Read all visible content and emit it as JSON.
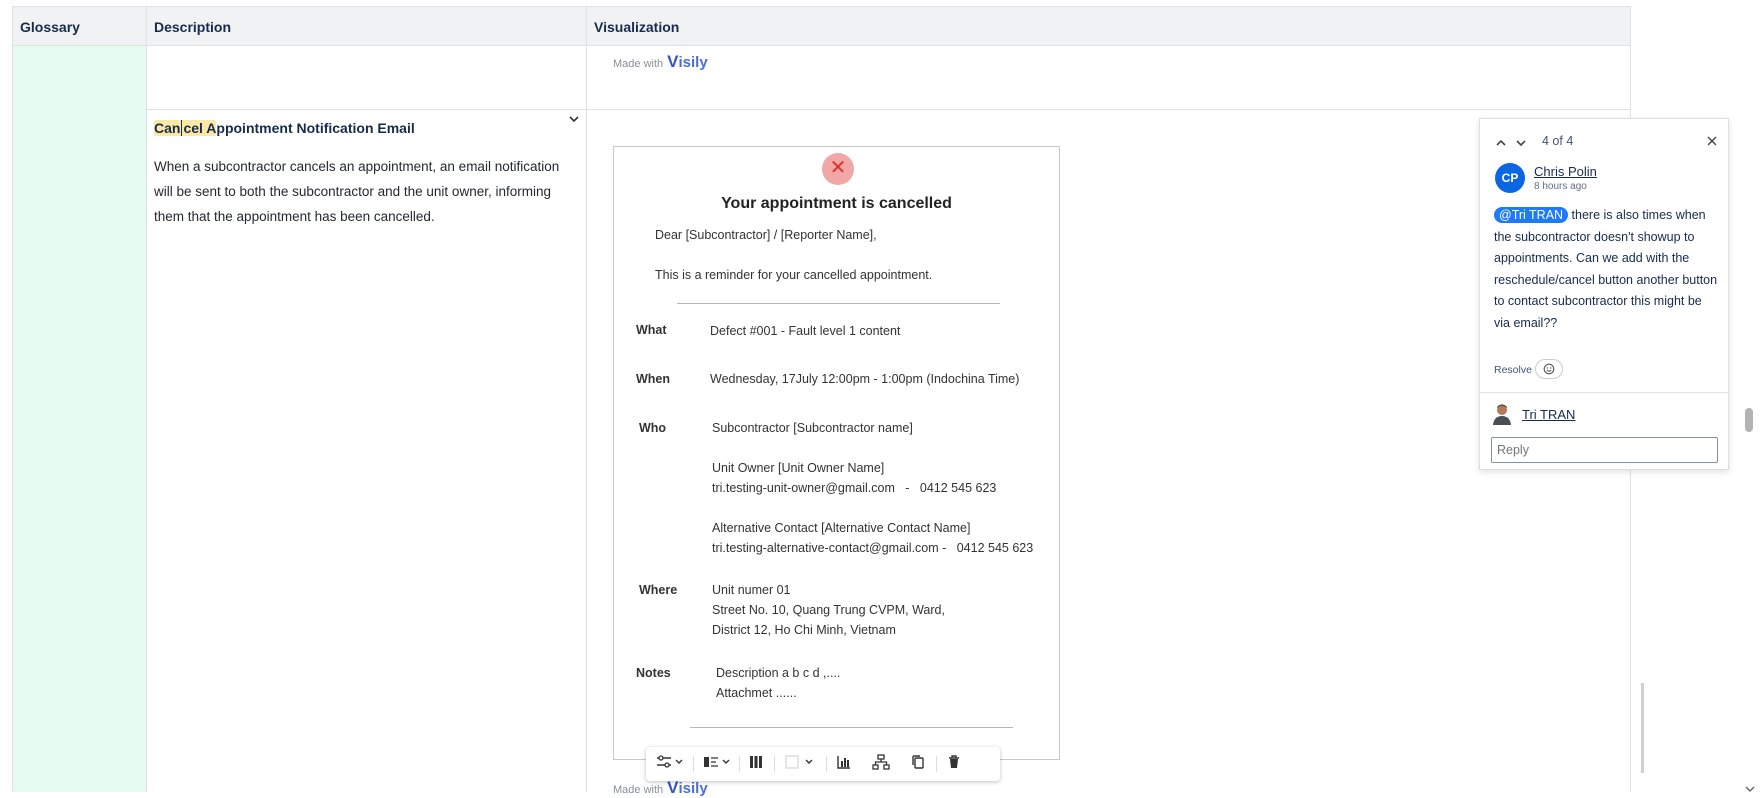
{
  "table": {
    "headers": [
      "Glossary",
      "Description",
      "Visualization"
    ]
  },
  "made_with": {
    "prefix": "Made with",
    "brand": "isily",
    "brand_initial": "V"
  },
  "row": {
    "title_highlight": [
      "Can",
      "cel A"
    ],
    "title_rest": "ppointment Notification Email",
    "description": "When a subcontractor cancels an appointment, an email notification will be sent to both the subcontractor and the unit owner, informing them that the appointment has been cancelled."
  },
  "email": {
    "close_glyph": "✕",
    "title": "Your appointment is cancelled",
    "greeting": "Dear [Subcontractor] / [Reporter Name],",
    "intro": "This is a reminder for your cancelled appointment.",
    "what_label": "What",
    "what_value": "Defect #001 - Fault level 1 content",
    "when_label": "When",
    "when_value": "Wednesday, 17July 12:00pm - 1:00pm (Indochina Time)",
    "who_label": "Who",
    "who_sub": "Subcontractor [Subcontractor name]",
    "who_owner": "Unit Owner [Unit Owner Name]",
    "who_owner_contact": "tri.testing-unit-owner@gmail.com   -   0412 545 623",
    "who_alt": "Alternative Contact [Alternative Contact Name]",
    "who_alt_contact": "tri.testing-alternative-contact@gmail.com -   0412 545 623",
    "where_label": "Where",
    "where_line1": "Unit numer 01",
    "where_line2": "Street No. 10, Quang Trung CVPM, Ward,",
    "where_line3": "District 12, Ho Chi Minh, Vietnam",
    "notes_label": "Notes",
    "notes_line1": "Description a b c d ,....",
    "notes_line2": "Attachmet ......"
  },
  "comment": {
    "counter": "4 of 4",
    "author": "Chris Polin",
    "author_initials": "CP",
    "time": "8 hours ago",
    "mention": "@Tri TRAN",
    "body": " there is also times when the subcontractor doesn't showup to appointments. Can we add with the reschedule/cancel button another button to contact subcontractor this might be via email??",
    "resolve": "Resolve",
    "reply_user": "Tri TRAN",
    "reply_placeholder": "Reply"
  },
  "icons": [
    "chevron-up-icon",
    "chevron-down-icon",
    "close-icon",
    "emoji-icon",
    "sliders-icon",
    "align-icon",
    "columns-icon",
    "color-icon",
    "chart-icon",
    "hierarchy-icon",
    "copy-icon",
    "trash-icon"
  ],
  "colors": {
    "glossary_bg": "#e3fcef",
    "highlight": "#fbe7a8",
    "accent": "#0b66e4",
    "cancel_circle": "#f2a7a7"
  }
}
